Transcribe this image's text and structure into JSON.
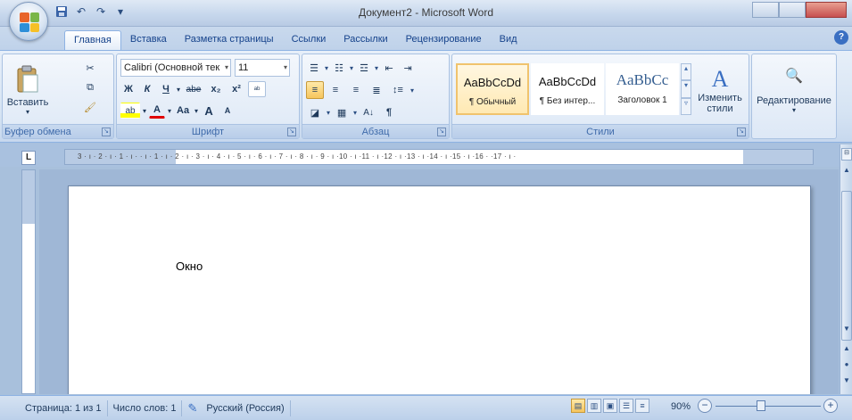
{
  "window": {
    "title": "Документ2 - Microsoft Word"
  },
  "quick_access": {
    "save_icon": "save-icon",
    "undo_icon": "undo-icon",
    "redo_icon": "redo-icon"
  },
  "tabs": [
    {
      "label": "Главная",
      "active": true
    },
    {
      "label": "Вставка"
    },
    {
      "label": "Разметка страницы"
    },
    {
      "label": "Ссылки"
    },
    {
      "label": "Рассылки"
    },
    {
      "label": "Рецензирование"
    },
    {
      "label": "Вид"
    }
  ],
  "clipboard": {
    "paste_label": "Вставить",
    "group_label": "Буфер обмена"
  },
  "font": {
    "font_name": "Calibri (Основной тек",
    "font_size": "11",
    "group_label": "Шрифт",
    "bold": "Ж",
    "italic": "К",
    "underline": "Ч",
    "strike": "abe",
    "subscript": "x₂",
    "superscript": "x²",
    "change_case": "Aa",
    "grow": "A",
    "shrink": "A"
  },
  "paragraph": {
    "group_label": "Абзац",
    "show_marks": "¶"
  },
  "styles": {
    "group_label": "Стили",
    "items": [
      {
        "sample": "AaBbCcDd",
        "name": "¶ Обычный"
      },
      {
        "sample": "AaBbCcDd",
        "name": "¶ Без интер..."
      },
      {
        "sample": "AaBbCc",
        "name": "Заголовок 1"
      }
    ],
    "change_styles_label": "Изменить стили",
    "editing_label": "Редактирование"
  },
  "ruler": {
    "tab_selector": "L",
    "text": "3 · ı · 2 · ı · 1 · ı ·   · ı · 1 · ı · 2 · ı · 3 · ı · 4 · ı · 5 · ı · 6 · ı · 7 · ı · 8 · ı · 9 · ı ·10 · ı ·11 · ı ·12 · ı ·13 · ı ·14 · ı ·15 · ı ·16 ·   ·17 · ı ·"
  },
  "document": {
    "text": "Окно"
  },
  "statusbar": {
    "page": "Страница: 1 из 1",
    "words": "Число слов: 1",
    "language": "Русский (Россия)",
    "zoom": "90%"
  },
  "colors": {
    "accent": "#15428b",
    "ribbon": "#d5e3f3",
    "workspace": "#9fb7d6"
  }
}
